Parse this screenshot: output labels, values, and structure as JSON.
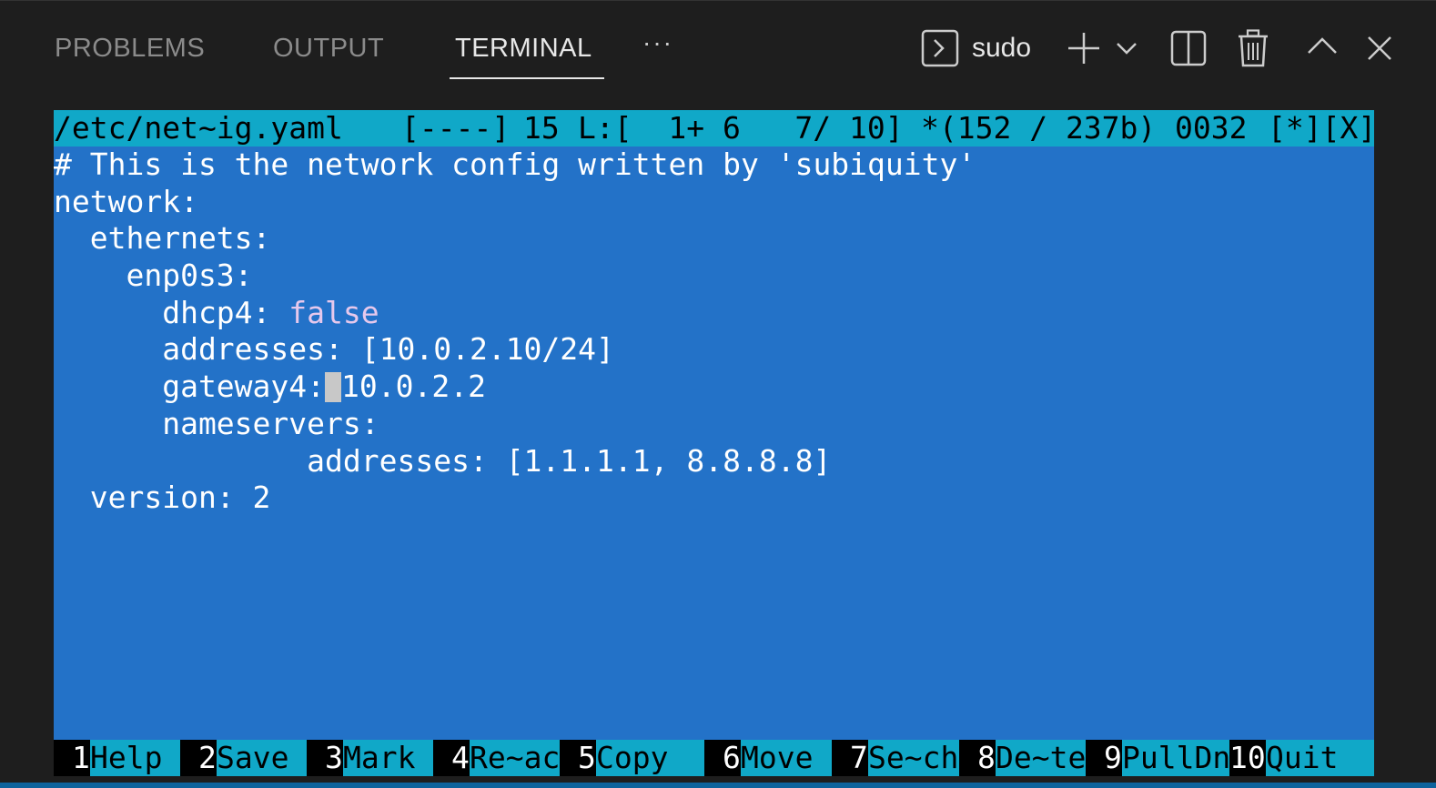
{
  "tabs": [
    {
      "label": "PROBLEMS",
      "active": false
    },
    {
      "label": "OUTPUT",
      "active": false
    },
    {
      "label": "TERMINAL",
      "active": true
    }
  ],
  "more_label": "···",
  "terminal_toolbar": {
    "terminal_name": "sudo",
    "icons": [
      "terminal-icon",
      "plus-icon",
      "chevron-down-icon",
      "split-icon",
      "trash-icon",
      "chevron-up-icon",
      "close-icon"
    ]
  },
  "status_bar": {
    "file": "/etc/net~ig.yaml",
    "flags": "[----]",
    "col": "15",
    "lines": "L:[  1+ 6   7/ 10]",
    "bytes": "*(152 / 237b)",
    "code": "0032",
    "mod": "[*][X]"
  },
  "editor_lines": [
    {
      "pre": "# This is the network config written by 'subiquity'"
    },
    {
      "pre": "network:"
    },
    {
      "pre": "  ethernets:"
    },
    {
      "pre": "    enp0s3:"
    },
    {
      "pre": "      dhcp4: ",
      "value": "false"
    },
    {
      "pre": "      addresses: [10.0.2.10/24]"
    },
    {
      "pre": "      gateway4:",
      "post": "10.0.2.2"
    },
    {
      "pre": "      nameservers:"
    },
    {
      "pre": "              addresses: [1.1.1.1, 8.8.8.8]"
    },
    {
      "pre": "  version: 2"
    }
  ],
  "function_keys": [
    {
      "num": "1",
      "label": "Help"
    },
    {
      "num": "2",
      "label": "Save"
    },
    {
      "num": "3",
      "label": "Mark"
    },
    {
      "num": "4",
      "label": "Re~ac"
    },
    {
      "num": "5",
      "label": "Copy"
    },
    {
      "num": "6",
      "label": "Move"
    },
    {
      "num": "7",
      "label": "Se~ch"
    },
    {
      "num": "8",
      "label": "De~te"
    },
    {
      "num": "9",
      "label": "PullDn"
    },
    {
      "num": "10",
      "label": "Quit"
    }
  ],
  "colors": {
    "panel_bg": "#1e1e1e",
    "terminal_bg": "#2372c8",
    "mc_bar": "#10a8c8",
    "tab_active": "#e7e7e7",
    "tab_inactive": "#8b8b8b",
    "keyword_value": "#e6c8ec"
  }
}
